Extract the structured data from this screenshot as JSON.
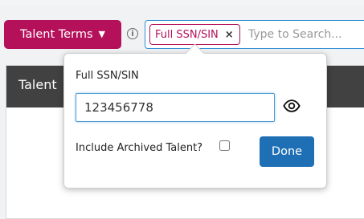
{
  "toolbar": {
    "terms_label": "Talent Terms",
    "terms_chevron": "▼",
    "info_glyph": "i"
  },
  "search": {
    "tag_label": "Full SSN/SIN",
    "tag_remove": "×",
    "placeholder": "Type to Search..."
  },
  "panel": {
    "title": "Talent"
  },
  "popover": {
    "field_label": "Full SSN/SIN",
    "ssn_value": "123456778",
    "include_archived_label": "Include Archived Talent?",
    "include_archived_checked": false,
    "done_label": "Done"
  },
  "colors": {
    "brand": "#b5105a",
    "primary": "#1f6fb5",
    "focus": "#4a9bd8",
    "header": "#414141"
  },
  "icons": {
    "info": "info-circle-icon",
    "eye": "eye-icon",
    "chevron": "chevron-down-icon",
    "remove": "close-icon"
  }
}
